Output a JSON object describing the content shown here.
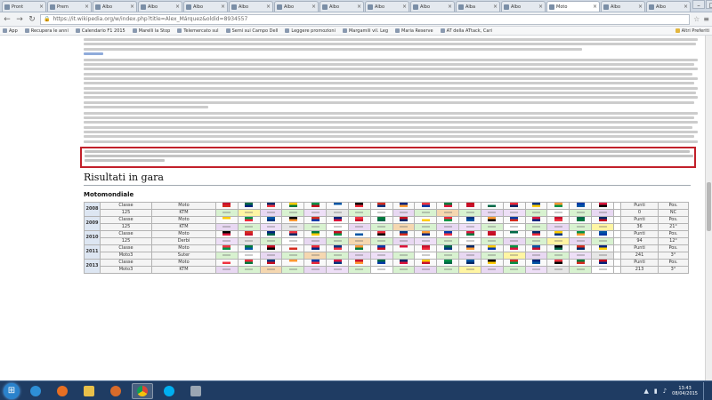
{
  "browser": {
    "tabs": [
      {
        "label": "Pront"
      },
      {
        "label": "Prem"
      },
      {
        "label": "Albo"
      },
      {
        "label": "Albo"
      },
      {
        "label": "Albo"
      },
      {
        "label": "Albo"
      },
      {
        "label": "Albo"
      },
      {
        "label": "Albo"
      },
      {
        "label": "Albo"
      },
      {
        "label": "Albo"
      },
      {
        "label": "Alba"
      },
      {
        "label": "Albo"
      },
      {
        "label": "Moto",
        "active": true
      },
      {
        "label": "Albo"
      },
      {
        "label": "Albo"
      }
    ],
    "url": "https://it.wikipedia.org/w/index.php?title=Alex_Márquez&oldid=8934557",
    "bookmarks_left": [
      "App",
      "Recupera le anni",
      "Calendario F1 2015",
      "Marelli la Stop",
      "Telemercato sul",
      "Semi sui Campo Dell",
      "Leggere promozioni",
      "Margamili vil. Leg",
      "Maria Reserve",
      "AT della ATtack, Cari"
    ],
    "bookmarks_right": "Altri Preferiti"
  },
  "page": {
    "section_title": "Risultati in gara",
    "subsection_title": "Motomondiale",
    "table": {
      "rows": [
        {
          "year": "2008",
          "cls_top": "Classe",
          "moto_top": "Moto",
          "cls": "125",
          "moto": "KTM",
          "tot_top": "Punti",
          "tot": "0",
          "pos_top": "Pos.",
          "pos": "NC"
        },
        {
          "year": "2009",
          "cls_top": "Classe",
          "moto_top": "Moto",
          "cls": "125",
          "moto": "KTM",
          "tot_top": "Punti",
          "tot": "36",
          "pos_top": "Pos.",
          "pos": "21°"
        },
        {
          "year": "2010",
          "cls_top": "Classe",
          "moto_top": "Moto",
          "cls": "125",
          "moto": "Derbi",
          "tot_top": "Punti",
          "tot": "94",
          "pos_top": "Pos.",
          "pos": "12°"
        },
        {
          "year": "2011",
          "cls_top": "Classe",
          "moto_top": "Moto",
          "cls": "Moto3",
          "moto": "Suter",
          "tot_top": "Punti",
          "tot": "241",
          "pos_top": "Pos.",
          "pos": "3°"
        },
        {
          "year": "2013",
          "cls_top": "Classe",
          "moto_top": "Moto",
          "cls": "Moto3",
          "moto": "KTM",
          "tot_top": "Punti",
          "tot": "213",
          "pos_top": "Pos.",
          "pos": "3°"
        }
      ]
    }
  },
  "taskbar": {
    "time": "13:43",
    "date": "08/04/2015"
  },
  "colors": {
    "highlight_border": "#c2202a",
    "taskbar_bg": "#1f3c63",
    "link": "#3366bb"
  }
}
